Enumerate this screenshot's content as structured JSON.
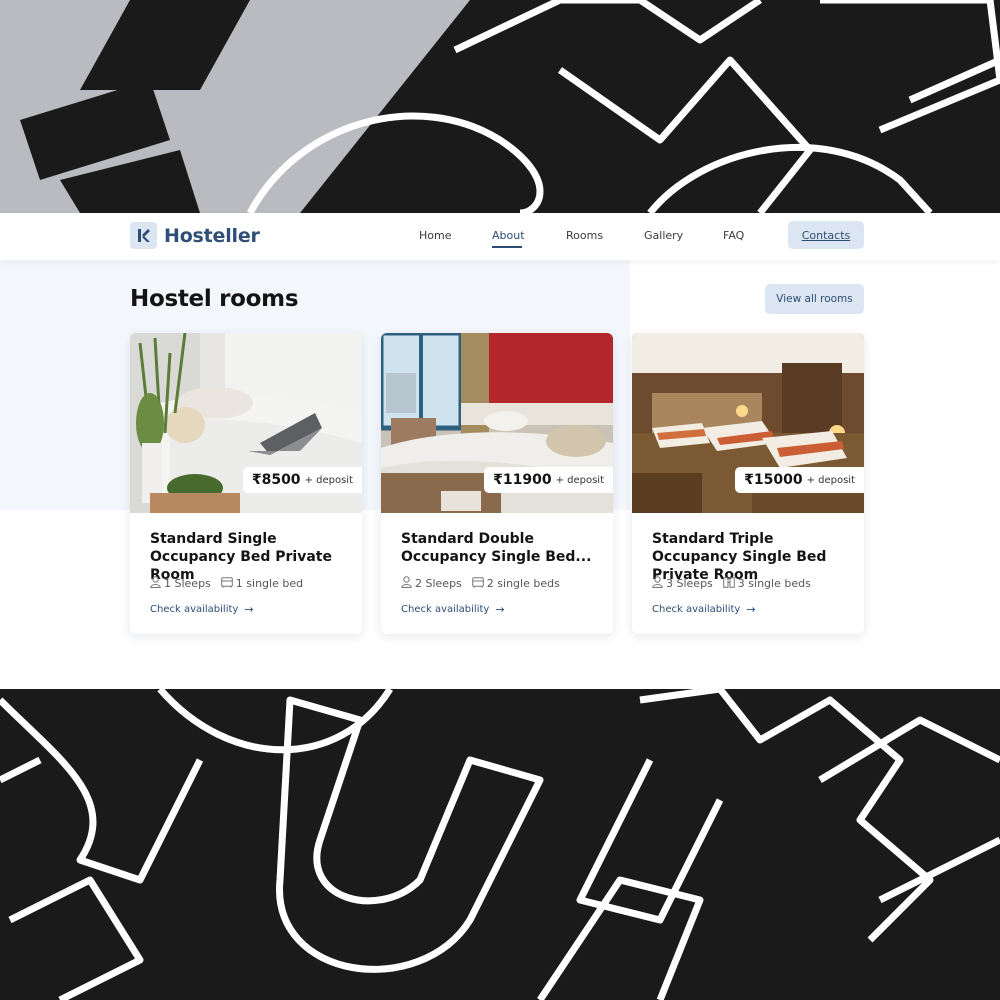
{
  "brand": {
    "name": "Hosteller",
    "accent": "#2d4d75"
  },
  "nav": {
    "items": [
      {
        "label": "Home"
      },
      {
        "label": "About",
        "active": true
      },
      {
        "label": "Rooms"
      },
      {
        "label": "Gallery"
      },
      {
        "label": "FAQ"
      }
    ],
    "contacts_label": "Contacts"
  },
  "section": {
    "title": "Hostel rooms",
    "view_all_label": "View all rooms"
  },
  "rooms": [
    {
      "title": "Standard Single Occupancy Bed Private Room",
      "price": "₹8500",
      "deposit": "+ deposit",
      "sleeps": "1 Sleeps",
      "beds": "1 single bed",
      "link": "Check availability",
      "photo_icon": "bedroom-laptop-photo"
    },
    {
      "title": "Standard Double Occupancy Single Bed...",
      "price": "₹11900",
      "deposit": "+ deposit",
      "sleeps": "2 Sleeps",
      "beds": "2 single beds",
      "link": "Check availability",
      "photo_icon": "double-bedroom-photo"
    },
    {
      "title": "Standard Triple Occupancy Single Bed Private Room",
      "price": "₹15000",
      "deposit": "+ deposit",
      "sleeps": "3 Sleeps",
      "beds": "3 single beds",
      "link": "Check availability",
      "photo_icon": "triple-bedroom-photo"
    }
  ]
}
